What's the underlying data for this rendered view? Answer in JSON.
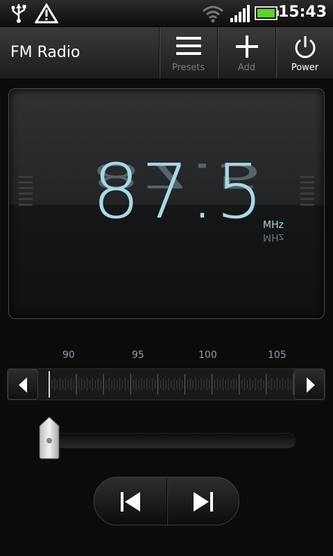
{
  "status_bar": {
    "time": "15:43",
    "icons": [
      "usb-icon",
      "warning-icon",
      "wifi-icon",
      "signal-icon",
      "battery-icon"
    ]
  },
  "action_bar": {
    "title": "FM Radio",
    "buttons": [
      {
        "label": "Presets",
        "icon": "list-icon"
      },
      {
        "label": "Add",
        "icon": "plus-icon"
      },
      {
        "label": "Power",
        "icon": "power-icon"
      }
    ]
  },
  "display": {
    "frequency": "87.5",
    "unit": "MHz"
  },
  "tuner": {
    "scale_labels": [
      "90",
      "95",
      "100",
      "105"
    ],
    "prev_icon": "triangle-left-icon",
    "next_icon": "triangle-right-icon",
    "position_fraction": 0.0
  },
  "volume": {
    "level_fraction": 0.0
  },
  "seek": {
    "prev_icon": "skip-previous-icon",
    "next_icon": "skip-next-icon"
  },
  "colors": {
    "frequency": "#a9d8e6",
    "background": "#0b0b0b",
    "battery": "#5fd12a"
  }
}
